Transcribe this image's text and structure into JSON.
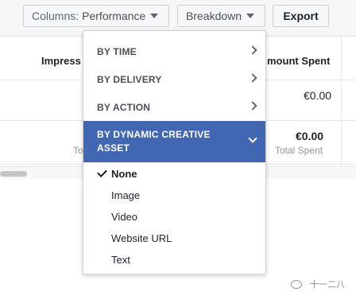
{
  "toolbar": {
    "columns_label": "Columns:",
    "columns_value": "Performance",
    "breakdown_label": "Breakdown",
    "export_label": "Export"
  },
  "table": {
    "headers": [
      "Impress",
      "mount Spent"
    ],
    "rows": [
      {
        "amount": "€0.00",
        "sub_left": "",
        "sub_right": ""
      },
      {
        "amount": "€0.00",
        "sub_left": "Tot",
        "sub_right": "Total Spent"
      }
    ]
  },
  "breakdown_menu": {
    "categories": [
      {
        "label": "BY TIME",
        "icon": "chevron-right-icon"
      },
      {
        "label": "BY DELIVERY",
        "icon": "chevron-right-icon"
      },
      {
        "label": "BY ACTION",
        "icon": "chevron-right-icon"
      },
      {
        "label": "BY DYNAMIC CREATIVE ASSET",
        "icon": "chevron-down-icon",
        "active": true
      }
    ],
    "options": [
      {
        "label": "None",
        "selected": true
      },
      {
        "label": "Image",
        "selected": false
      },
      {
        "label": "Video",
        "selected": false
      },
      {
        "label": "Website URL",
        "selected": false
      },
      {
        "label": "Text",
        "selected": false
      }
    ]
  },
  "watermark": {
    "text": "十一二八"
  },
  "colors": {
    "accent": "#4267b2",
    "toolbar_bg": "#f6f7f9",
    "text_primary": "#1d2129",
    "text_secondary": "#90949c"
  }
}
